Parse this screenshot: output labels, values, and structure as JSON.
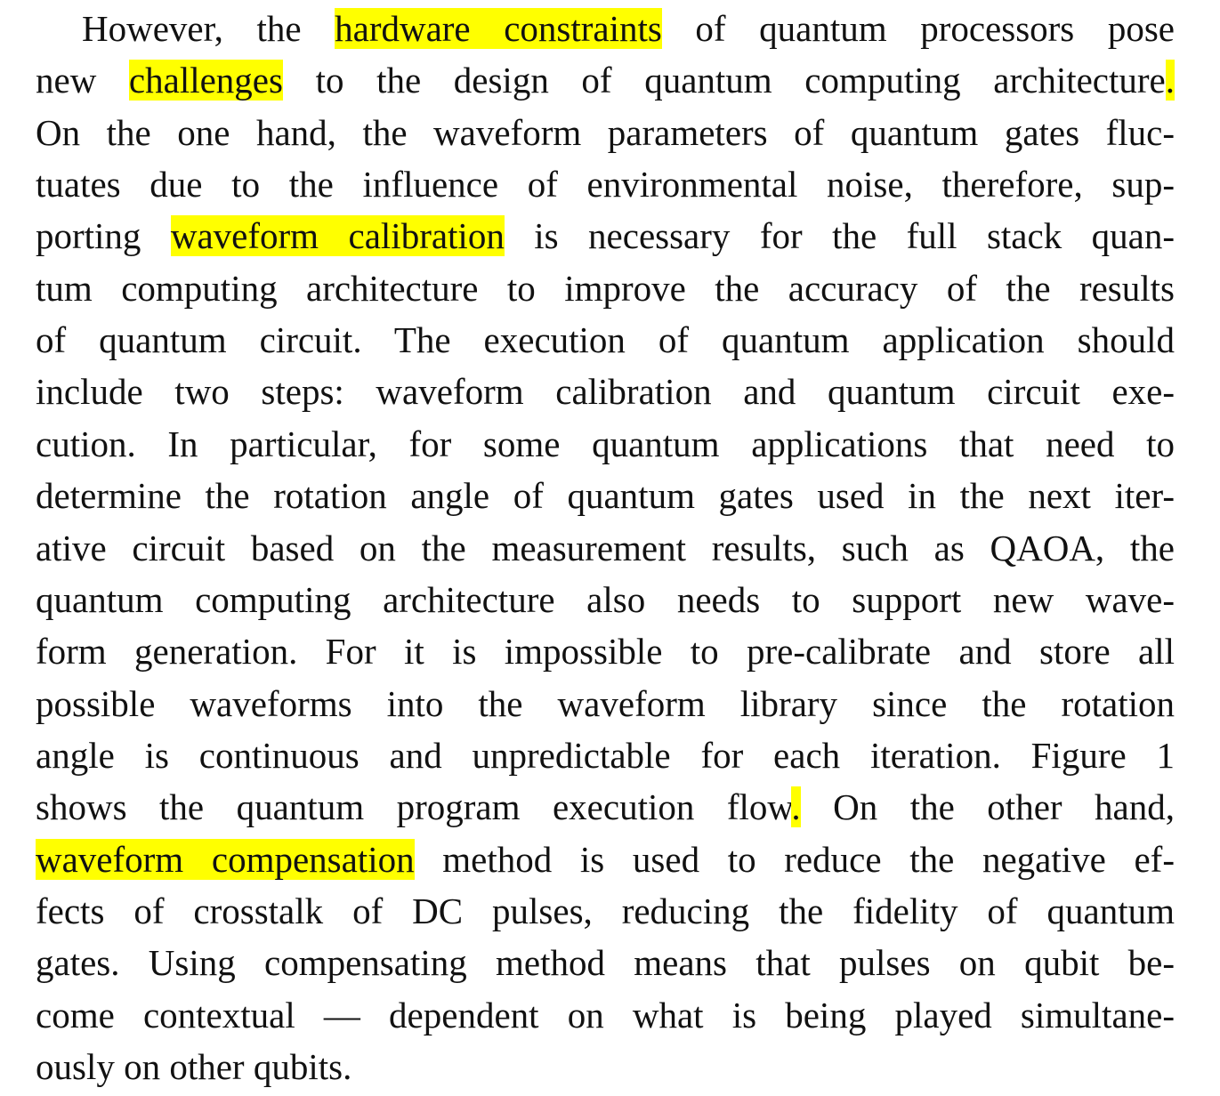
{
  "document": {
    "lines": [
      {
        "segments": [
          {
            "text": "However, the "
          },
          {
            "text": "hardware constraints",
            "highlight": true
          },
          {
            "text": " of quantum processors pose"
          }
        ]
      },
      {
        "segments": [
          {
            "text": "new "
          },
          {
            "text": "challenges",
            "highlight": true
          },
          {
            "text": " to the design of quantum computing architecture"
          },
          {
            "text": ".",
            "highlight": true
          }
        ]
      },
      {
        "segments": [
          {
            "text": "On the one hand, the waveform parameters of quantum gates fluc-"
          }
        ]
      },
      {
        "segments": [
          {
            "text": "tuates due to the influence of environmental noise, therefore, sup-"
          }
        ]
      },
      {
        "segments": [
          {
            "text": "porting "
          },
          {
            "text": "waveform calibration",
            "highlight": true
          },
          {
            "text": " is necessary for the full stack quan-"
          }
        ]
      },
      {
        "segments": [
          {
            "text": "tum computing architecture to improve the accuracy of the results"
          }
        ]
      },
      {
        "segments": [
          {
            "text": "of quantum circuit. The execution of quantum application should"
          }
        ]
      },
      {
        "segments": [
          {
            "text": "include two steps: waveform calibration and quantum circuit exe-"
          }
        ]
      },
      {
        "segments": [
          {
            "text": "cution. In particular, for some quantum applications that need to"
          }
        ]
      },
      {
        "segments": [
          {
            "text": "determine the rotation angle of quantum gates used in the next iter-"
          }
        ]
      },
      {
        "segments": [
          {
            "text": "ative circuit based on the measurement results, such as QAOA, the"
          }
        ]
      },
      {
        "segments": [
          {
            "text": "quantum computing architecture also needs to support new wave-"
          }
        ]
      },
      {
        "segments": [
          {
            "text": "form generation. For it is impossible to pre-calibrate and store all"
          }
        ]
      },
      {
        "segments": [
          {
            "text": "possible waveforms into the waveform library since the rotation"
          }
        ]
      },
      {
        "segments": [
          {
            "text": "angle is continuous and unpredictable for each iteration. Figure 1"
          }
        ]
      },
      {
        "segments": [
          {
            "text": "shows the quantum program execution flow"
          },
          {
            "text": ".",
            "highlight": true
          },
          {
            "text": " On the other hand,"
          }
        ]
      },
      {
        "segments": [
          {
            "text": "waveform compensation",
            "highlight": true
          },
          {
            "text": " method is used to reduce the negative ef-"
          }
        ]
      },
      {
        "segments": [
          {
            "text": "fects of crosstalk of DC pulses, reducing the fidelity of quantum"
          }
        ]
      },
      {
        "segments": [
          {
            "text": "gates. Using compensating method means that pulses on qubit be-"
          }
        ]
      },
      {
        "segments": [
          {
            "text": "come contextual — dependent on what is being played simultane-"
          }
        ]
      },
      {
        "segments": [
          {
            "text": "ously on other qubits."
          }
        ]
      }
    ],
    "highlight_color": "#ffff00",
    "text_color": "#111111"
  }
}
